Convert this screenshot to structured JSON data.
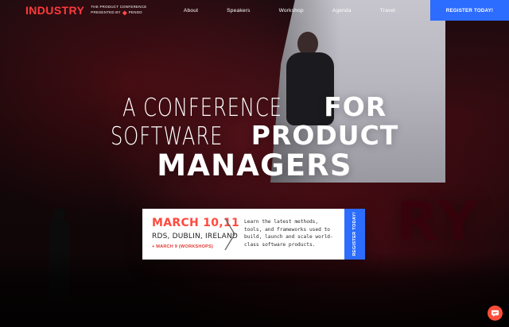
{
  "header": {
    "logo": {
      "wordmark": "INDUSTRY",
      "line1": "THE PRODUCT CONFERENCE",
      "line2": "PRESENTED BY",
      "sponsor": "pendo"
    },
    "nav": [
      {
        "label": "About"
      },
      {
        "label": "Speakers"
      },
      {
        "label": "Workshop"
      },
      {
        "label": "Agenda"
      },
      {
        "label": "Travel"
      }
    ],
    "cta_label": "REGISTER TODAY!"
  },
  "hero": {
    "lines": [
      {
        "light": "A CONFERENCE",
        "bold": "FOR"
      },
      {
        "light": "SOFTWARE",
        "bold": "PRODUCT"
      },
      {
        "light": "",
        "bold": "MANAGERS"
      }
    ]
  },
  "event_card": {
    "date": "MARCH 10,11",
    "venue": "RDS, DUBLIN, IRELAND",
    "workshop": "+ MARCH 9 (WORKSHOPS)",
    "description": "Learn the latest methods, tools, and frameworks used to build, launch and scale world-class software products.",
    "cta_label": "REGISTER TODAY!"
  },
  "background": {
    "big_letters": "RY"
  },
  "colors": {
    "brand_red": "#ff3a3a",
    "accent_blue": "#2c6cff",
    "date_red": "#ff4a3f"
  },
  "icons": {
    "chat": "chat-bubble-icon",
    "chevron": "chevron-right-icon",
    "pendo": "pendo-logo-icon"
  }
}
